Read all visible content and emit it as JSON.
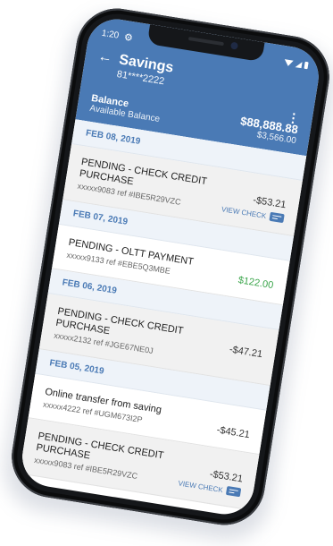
{
  "status": {
    "time": "1:20"
  },
  "header": {
    "title": "Savings",
    "account_number": "81****2222",
    "balance_label": "Balance",
    "available_label": "Available Balance",
    "balance": "$88,888.88",
    "available_balance": "$3,566.00"
  },
  "transactions": [
    {
      "date": "FEB 08, 2019"
    },
    {
      "description": "PENDING - CHECK CREDIT PURCHASE",
      "ref": "xxxxx9083 ref #IBE5R29VZC",
      "amount": "-$53.21",
      "view_check": "VIEW CHECK"
    },
    {
      "date": "FEB 07, 2019"
    },
    {
      "description": "PENDING - OLTT PAYMENT",
      "ref": "xxxxx9133 ref #EBE5Q3MBE",
      "amount": "$122.00"
    },
    {
      "date": "FEB 06, 2019"
    },
    {
      "description": "PENDING - CHECK CREDIT PURCHASE",
      "ref": "xxxxx2132 ref #JGE67NE0J",
      "amount": "-$47.21"
    },
    {
      "date": "FEB 05, 2019"
    },
    {
      "description": "Online transfer from saving",
      "ref": "xxxxx4222 ref #UGM673I2P",
      "amount": "-$45.21"
    },
    {
      "description": "PENDING - CHECK CREDIT PURCHASE",
      "ref": "xxxxx9083 ref #IBE5R29VZC",
      "amount": "-$53.21",
      "view_check": "VIEW CHECK"
    }
  ],
  "colors": {
    "header_bg": "#4a7ab5",
    "accent": "#4a7ab5",
    "positive": "#3aa54a"
  },
  "icons": [
    "back-arrow-icon",
    "gear-icon",
    "wifi-icon",
    "signal-icon",
    "battery-icon",
    "kebab-menu-icon",
    "check-icon"
  ]
}
